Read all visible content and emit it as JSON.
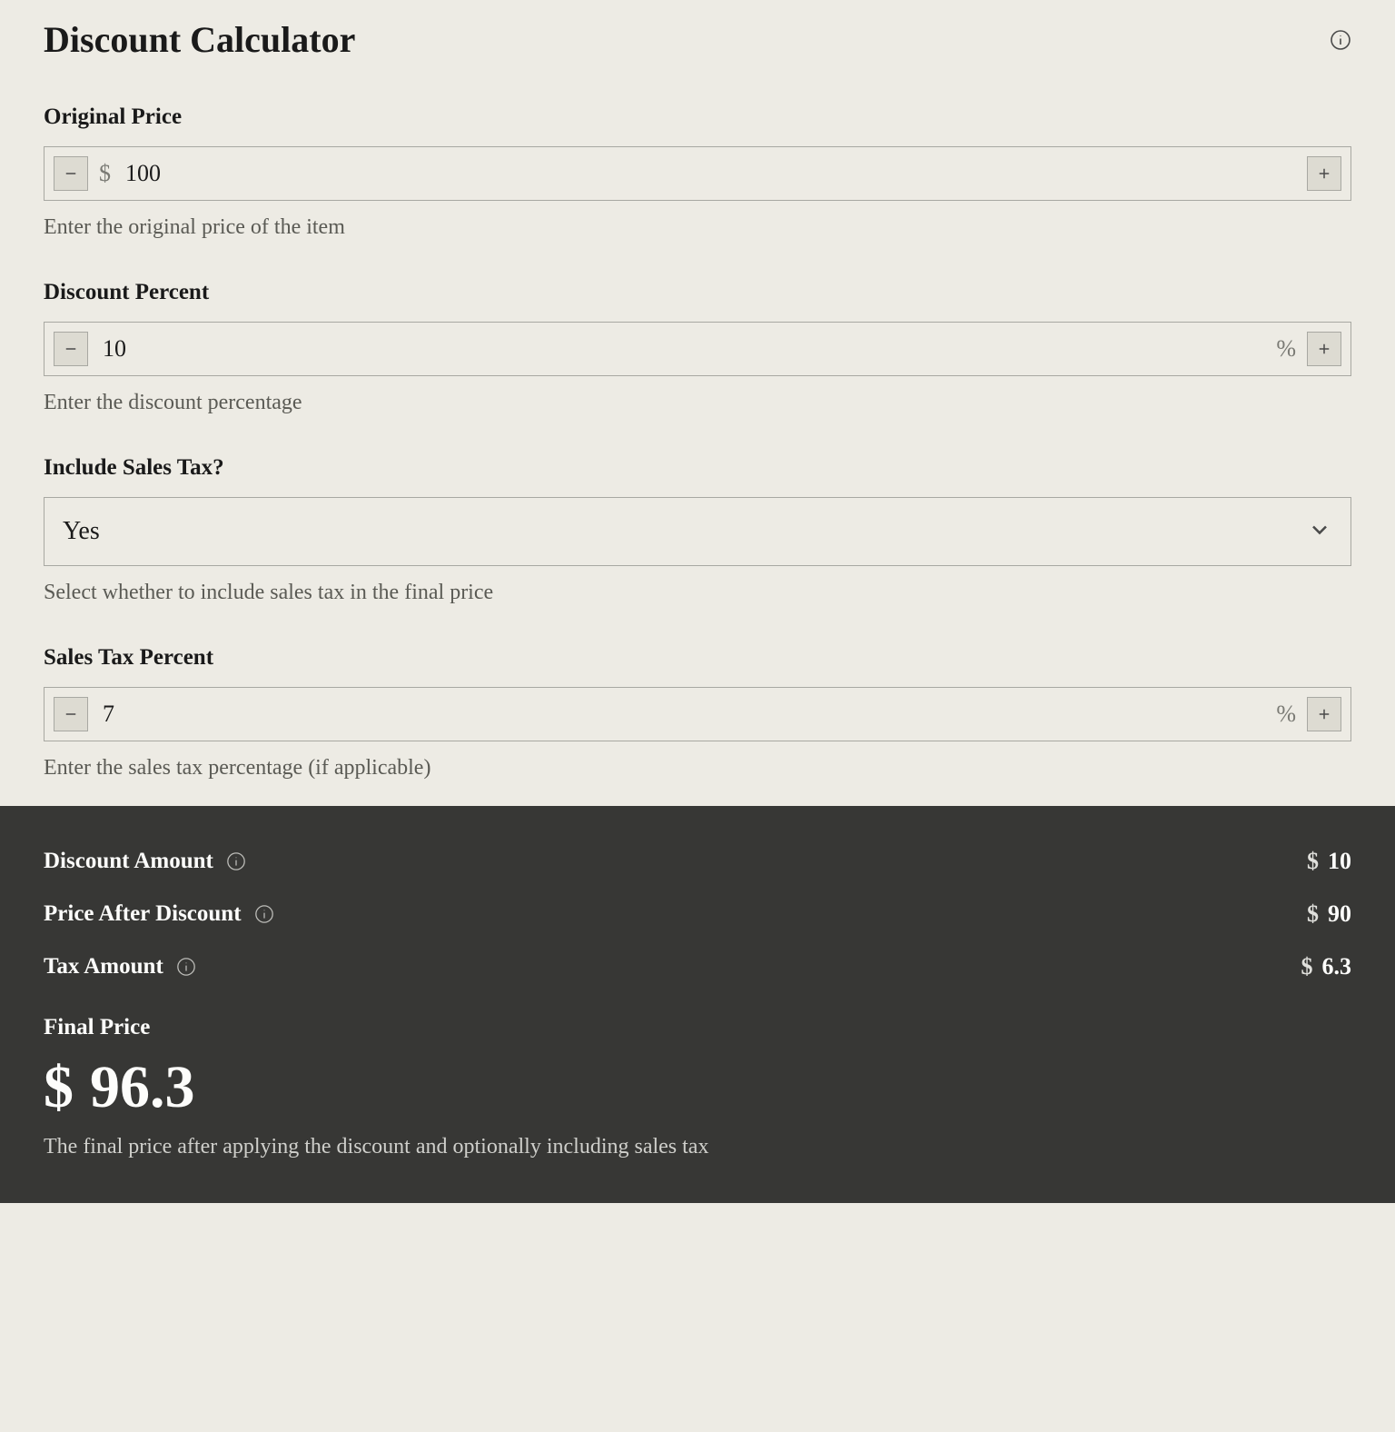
{
  "title": "Discount Calculator",
  "currency_symbol": "$",
  "percent_symbol": "%",
  "fields": {
    "original_price": {
      "label": "Original Price",
      "value": "100",
      "helper": "Enter the original price of the item"
    },
    "discount_percent": {
      "label": "Discount Percent",
      "value": "10",
      "helper": "Enter the discount percentage"
    },
    "include_tax": {
      "label": "Include Sales Tax?",
      "value": "Yes",
      "helper": "Select whether to include sales tax in the final price"
    },
    "tax_percent": {
      "label": "Sales Tax Percent",
      "value": "7",
      "helper": "Enter the sales tax percentage (if applicable)"
    }
  },
  "results": {
    "discount_amount": {
      "label": "Discount Amount",
      "value": "10"
    },
    "price_after_discount": {
      "label": "Price After Discount",
      "value": "90"
    },
    "tax_amount": {
      "label": "Tax Amount",
      "value": "6.3"
    },
    "final_price": {
      "label": "Final Price",
      "value": "96.3",
      "desc": "The final price after applying the discount and optionally including sales tax"
    }
  }
}
